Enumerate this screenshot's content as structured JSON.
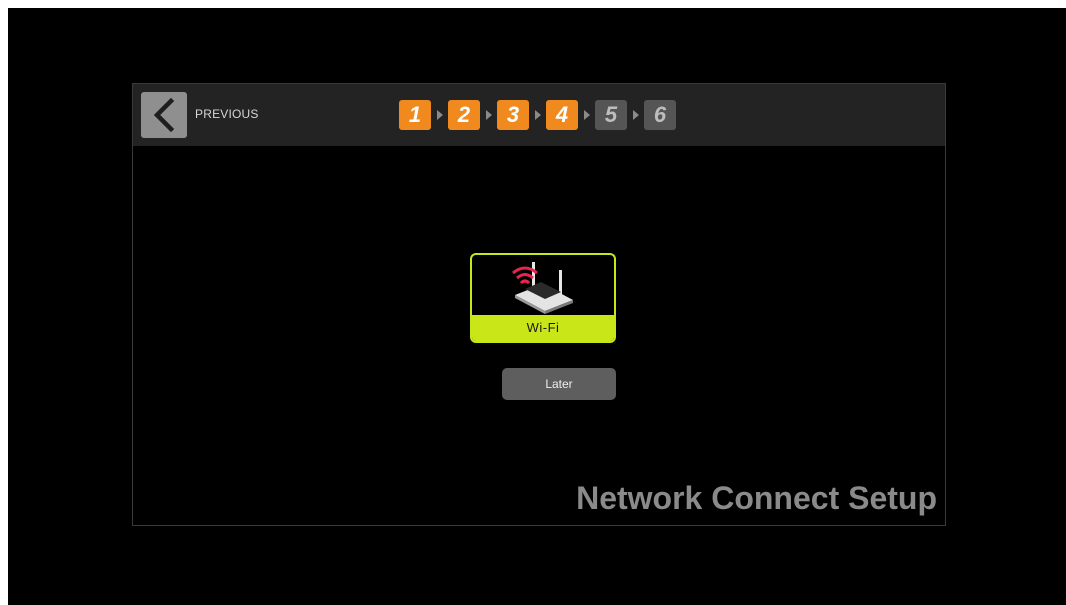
{
  "header": {
    "previous_label": "PREVIOUS",
    "steps": [
      {
        "number": "1",
        "state": "completed"
      },
      {
        "number": "2",
        "state": "completed"
      },
      {
        "number": "3",
        "state": "completed"
      },
      {
        "number": "4",
        "state": "current"
      },
      {
        "number": "5",
        "state": "pending"
      },
      {
        "number": "6",
        "state": "pending"
      }
    ]
  },
  "options": {
    "wifi_label": "Wi-Fi",
    "wifi_icon": "wifi-router-icon",
    "later_label": "Later"
  },
  "page": {
    "title": "Network Connect Setup"
  },
  "colors": {
    "step_active": "#f08a1e",
    "step_inactive": "#555555",
    "wifi_highlight": "#c9e618",
    "wifi_signal": "#e8264d"
  }
}
